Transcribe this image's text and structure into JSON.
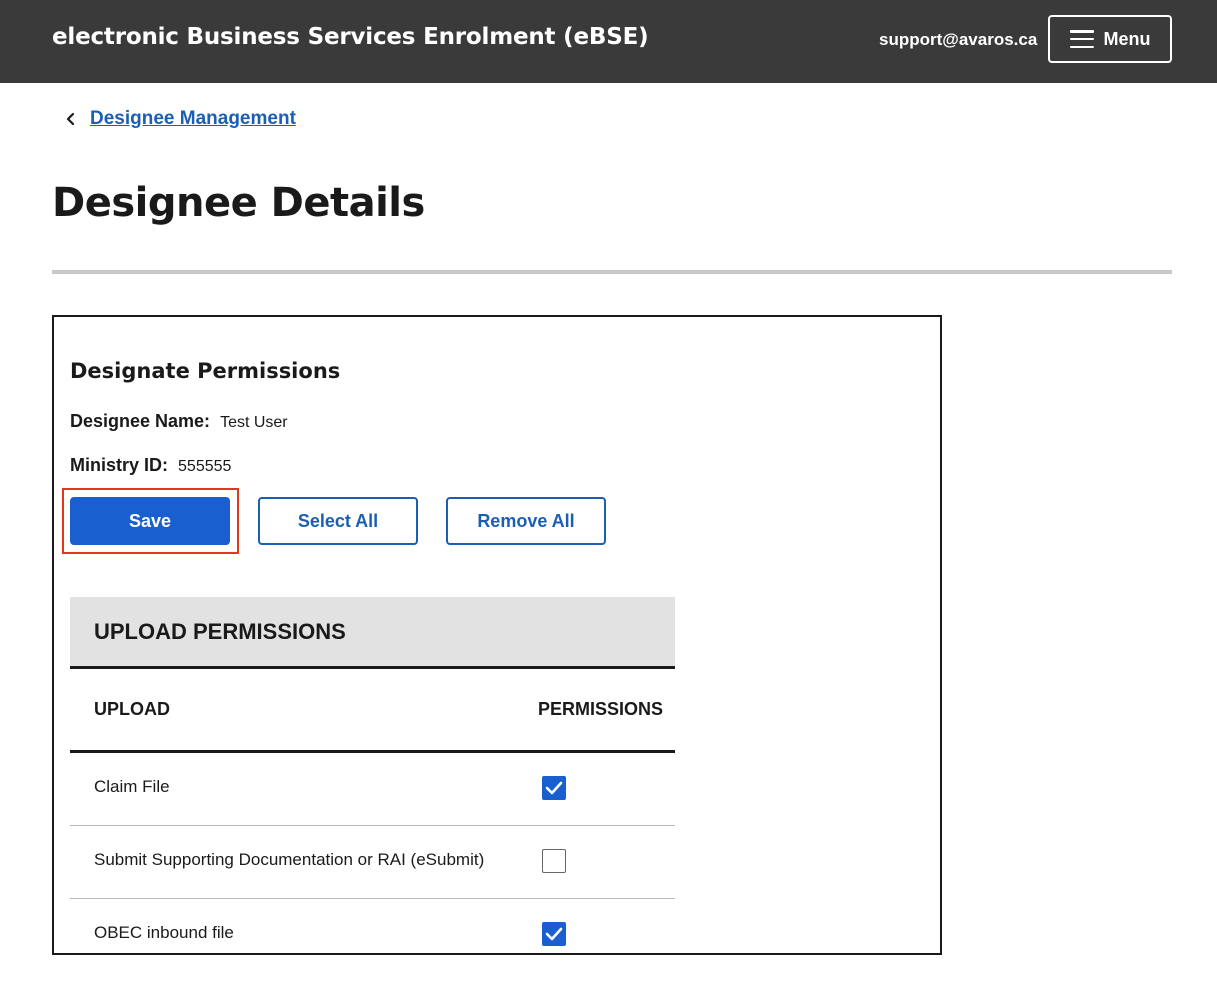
{
  "header": {
    "app_title": "electronic Business Services Enrolment (eBSE)",
    "support_email": "support@avaros.ca",
    "menu_label": "Menu"
  },
  "breadcrumb": {
    "link_label": "Designee Management"
  },
  "page": {
    "title": "Designee Details"
  },
  "card": {
    "heading": "Designate Permissions",
    "designee_name_label": "Designee Name:",
    "designee_name_value": "Test User",
    "ministry_id_label": "Ministry ID:",
    "ministry_id_value": "555555",
    "buttons": {
      "save": "Save",
      "select_all": "Select All",
      "remove_all": "Remove All"
    }
  },
  "upload_permissions": {
    "section_title": "UPLOAD PERMISSIONS",
    "columns": [
      "UPLOAD",
      "PERMISSIONS"
    ],
    "rows": [
      {
        "label": "Claim File",
        "checked": true
      },
      {
        "label": "Submit Supporting Documentation or RAI (eSubmit)",
        "checked": false
      },
      {
        "label": "OBEC inbound file",
        "checked": true
      }
    ]
  },
  "colors": {
    "header_bg": "#3a3a3a",
    "primary": "#1a5fd0",
    "link": "#1a5fb4",
    "highlight": "#e8361c"
  }
}
